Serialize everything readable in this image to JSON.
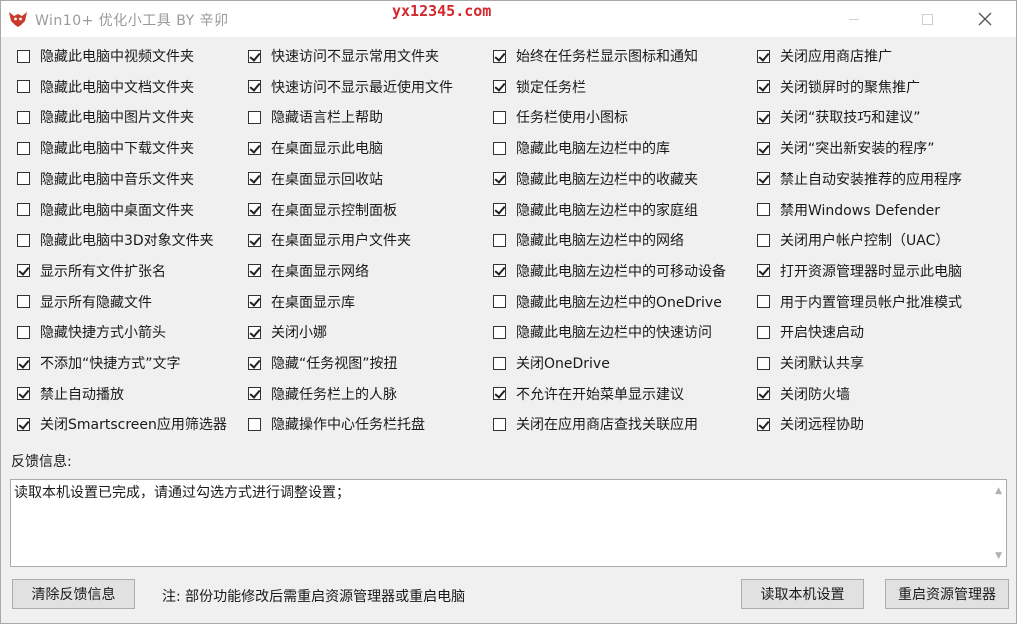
{
  "window": {
    "title": "Win10+ 优化小工具 BY 辛卯",
    "watermark": "yx12345.com"
  },
  "options": [
    [
      {
        "label": "隐藏此电脑中视频文件夹",
        "checked": false
      },
      {
        "label": "隐藏此电脑中文档文件夹",
        "checked": false
      },
      {
        "label": "隐藏此电脑中图片文件夹",
        "checked": false
      },
      {
        "label": "隐藏此电脑中下载文件夹",
        "checked": false
      },
      {
        "label": "隐藏此电脑中音乐文件夹",
        "checked": false
      },
      {
        "label": "隐藏此电脑中桌面文件夹",
        "checked": false
      },
      {
        "label": "隐藏此电脑中3D对象文件夹",
        "checked": false
      },
      {
        "label": "显示所有文件扩张名",
        "checked": true
      },
      {
        "label": "显示所有隐藏文件",
        "checked": false
      },
      {
        "label": "隐藏快捷方式小箭头",
        "checked": false
      },
      {
        "label": "不添加“快捷方式”文字",
        "checked": true
      },
      {
        "label": "禁止自动播放",
        "checked": true
      },
      {
        "label": "关闭Smartscreen应用筛选器",
        "checked": true
      }
    ],
    [
      {
        "label": "快速访问不显示常用文件夹",
        "checked": true
      },
      {
        "label": "快速访问不显示最近使用文件",
        "checked": true
      },
      {
        "label": "隐藏语言栏上帮助",
        "checked": false
      },
      {
        "label": "在桌面显示此电脑",
        "checked": true
      },
      {
        "label": "在桌面显示回收站",
        "checked": true
      },
      {
        "label": "在桌面显示控制面板",
        "checked": true
      },
      {
        "label": "在桌面显示用户文件夹",
        "checked": true
      },
      {
        "label": "在桌面显示网络",
        "checked": true
      },
      {
        "label": "在桌面显示库",
        "checked": true
      },
      {
        "label": "关闭小娜",
        "checked": true
      },
      {
        "label": "隐藏“任务视图”按扭",
        "checked": true
      },
      {
        "label": "隐藏任务栏上的人脉",
        "checked": true
      },
      {
        "label": "隐藏操作中心任务栏托盘",
        "checked": false
      }
    ],
    [
      {
        "label": "始终在任务栏显示图标和通知",
        "checked": true
      },
      {
        "label": "锁定任务栏",
        "checked": true
      },
      {
        "label": "任务栏使用小图标",
        "checked": false
      },
      {
        "label": "隐藏此电脑左边栏中的库",
        "checked": false
      },
      {
        "label": "隐藏此电脑左边栏中的收藏夹",
        "checked": true
      },
      {
        "label": "隐藏此电脑左边栏中的家庭组",
        "checked": true
      },
      {
        "label": "隐藏此电脑左边栏中的网络",
        "checked": false
      },
      {
        "label": "隐藏此电脑左边栏中的可移动设备",
        "checked": true
      },
      {
        "label": "隐藏此电脑左边栏中的OneDrive",
        "checked": false
      },
      {
        "label": "隐藏此电脑左边栏中的快速访问",
        "checked": false
      },
      {
        "label": "关闭OneDrive",
        "checked": false
      },
      {
        "label": "不允许在开始菜单显示建议",
        "checked": true
      },
      {
        "label": "关闭在应用商店查找关联应用",
        "checked": false
      }
    ],
    [
      {
        "label": "关闭应用商店推广",
        "checked": true
      },
      {
        "label": "关闭锁屏时的聚焦推广",
        "checked": true
      },
      {
        "label": "关闭“获取技巧和建议”",
        "checked": true
      },
      {
        "label": "关闭“突出新安装的程序”",
        "checked": true
      },
      {
        "label": "禁止自动安装推荐的应用程序",
        "checked": true
      },
      {
        "label": "禁用Windows Defender",
        "checked": false
      },
      {
        "label": "关闭用户帐户控制（UAC）",
        "checked": false
      },
      {
        "label": "打开资源管理器时显示此电脑",
        "checked": true
      },
      {
        "label": "用于内置管理员帐户批准模式",
        "checked": false
      },
      {
        "label": "开启快速启动",
        "checked": false
      },
      {
        "label": "关闭默认共享",
        "checked": false
      },
      {
        "label": "关闭防火墙",
        "checked": true
      },
      {
        "label": "关闭远程协助",
        "checked": true
      }
    ]
  ],
  "feedback": {
    "label": "反馈信息:",
    "text": "读取本机设置已完成，请通过勾选方式进行调整设置；"
  },
  "footer": {
    "clear_label": "清除反馈信息",
    "note": "注: 部份功能修改后需重启资源管理器或重启电脑",
    "read_label": "读取本机设置",
    "restart_label": "重启资源管理器"
  },
  "colors": {
    "accent": "#d2282e",
    "window_bg": "#f0f0f0"
  }
}
